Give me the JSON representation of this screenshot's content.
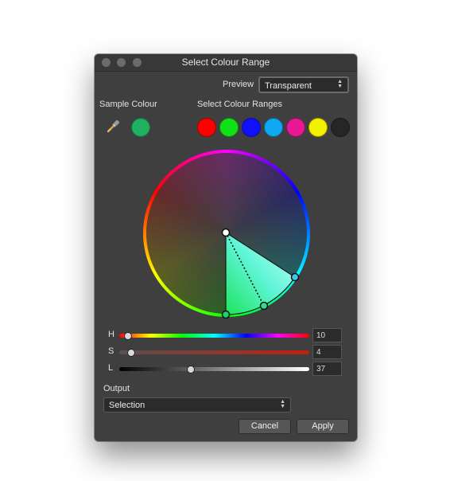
{
  "window": {
    "title": "Select Colour Range"
  },
  "preview": {
    "label": "Preview",
    "value": "Transparent"
  },
  "sample": {
    "label": "Sample Colour",
    "color": "#20b060",
    "picker_icon": "eyedropper-icon"
  },
  "ranges": {
    "label": "Select Colour Ranges",
    "swatches": [
      {
        "name": "red",
        "color": "#ff0000"
      },
      {
        "name": "green",
        "color": "#12e018"
      },
      {
        "name": "blue",
        "color": "#1010ff"
      },
      {
        "name": "cyan",
        "color": "#10a8f0"
      },
      {
        "name": "magenta",
        "color": "#e81894"
      },
      {
        "name": "yellow",
        "color": "#f5f000"
      },
      {
        "name": "black",
        "color": "#262626"
      }
    ]
  },
  "sliders": {
    "h": {
      "label": "H",
      "value": "10"
    },
    "s": {
      "label": "S",
      "value": "4"
    },
    "l": {
      "label": "L",
      "value": "37"
    }
  },
  "output": {
    "label": "Output",
    "value": "Selection"
  },
  "buttons": {
    "cancel": "Cancel",
    "apply": "Apply"
  }
}
